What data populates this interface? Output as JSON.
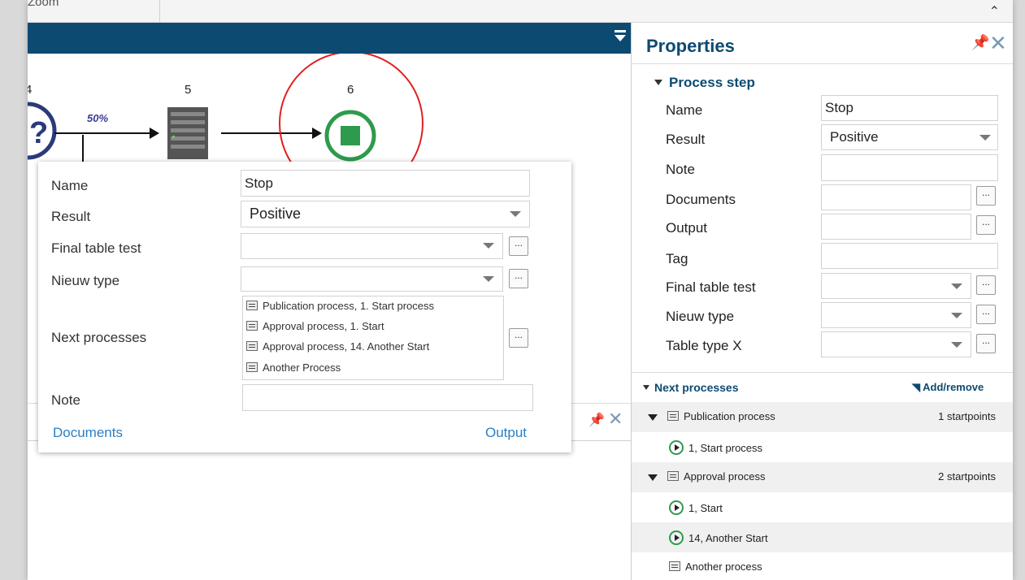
{
  "ribbon": {
    "zoom_label": "Zoom"
  },
  "diagram": {
    "step_numbers": [
      "4",
      "5",
      "6"
    ],
    "edge_percent": "50%"
  },
  "popup": {
    "name_label": "Name",
    "name_value": "Stop",
    "result_label": "Result",
    "result_value": "Positive",
    "final_table_test_label": "Final table test",
    "nieuw_type_label": "Nieuw type",
    "next_processes_label": "Next processes",
    "next_processes_items": [
      "Publication process, 1. Start process",
      "Approval process, 1. Start",
      "Approval process, 14. Another Start",
      "Another Process"
    ],
    "note_label": "Note",
    "documents_link": "Documents",
    "output_link": "Output",
    "ellipsis": "..."
  },
  "properties": {
    "title": "Properties",
    "section_title": "Process step",
    "rows": {
      "name": {
        "label": "Name",
        "value": "Stop"
      },
      "result": {
        "label": "Result",
        "value": "Positive"
      },
      "note": {
        "label": "Note",
        "value": ""
      },
      "documents": {
        "label": "Documents",
        "value": ""
      },
      "output": {
        "label": "Output",
        "value": ""
      },
      "tag": {
        "label": "Tag",
        "value": ""
      },
      "final_table_test": {
        "label": "Final table test",
        "value": ""
      },
      "nieuw_type": {
        "label": "Nieuw type",
        "value": ""
      },
      "table_type_x": {
        "label": "Table type X",
        "value": ""
      }
    },
    "next_processes": {
      "title": "Next processes",
      "add_remove": "Add/remove",
      "groups": [
        {
          "name": "Publication process",
          "count": "1 startpoints",
          "starts": [
            "1, Start  process"
          ]
        },
        {
          "name": "Approval process",
          "count": "2 startpoints",
          "starts": [
            "1, Start",
            "14, Another Start"
          ]
        }
      ],
      "other": "Another process"
    }
  },
  "colors": {
    "header_blue": "#0d4a72",
    "link_blue": "#2a7fc4",
    "stop_green": "#2e9a4e",
    "highlight_red": "#e02020"
  }
}
